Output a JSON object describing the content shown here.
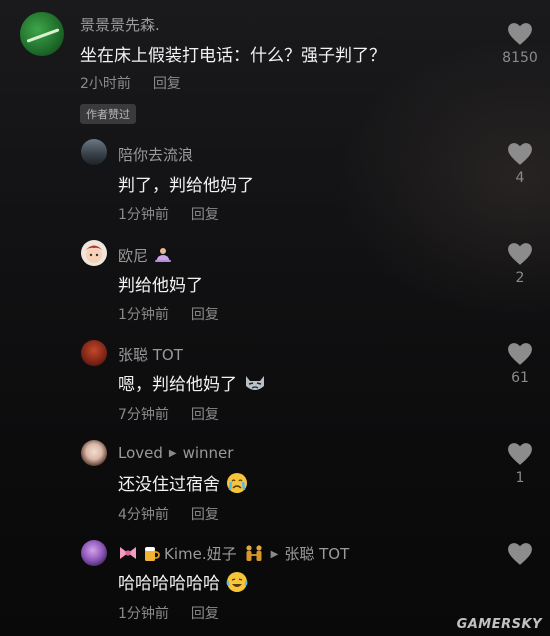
{
  "main_comment": {
    "username": "景景景先森.",
    "content": "坐在床上假装打电话：什么？强子判了？",
    "time": "2小时前",
    "reply_label": "回复",
    "author_liked": "作者赞过",
    "likes": "8150"
  },
  "replies": [
    {
      "username": "陪你去流浪",
      "content": "判了，判给他妈了",
      "time": "1分钟前",
      "reply_label": "回复",
      "likes": "4"
    },
    {
      "username": "欧尼",
      "content": "判给他妈了",
      "time": "1分钟前",
      "reply_label": "回复",
      "likes": "2"
    },
    {
      "username": "张聪 TOT",
      "content": "嗯，判给他妈了",
      "time": "7分钟前",
      "reply_label": "回复",
      "likes": "61"
    },
    {
      "username": "Loved",
      "reply_to": "winner",
      "content": "还没住过宿舍",
      "time": "4分钟前",
      "reply_label": "回复",
      "likes": "1"
    },
    {
      "username": "Kime.妞子",
      "reply_to": "张聪 TOT",
      "content": "哈哈哈哈哈哈",
      "time": "1分钟前",
      "reply_label": "回复",
      "likes": ""
    }
  ],
  "watermark": "GAMERSKY"
}
